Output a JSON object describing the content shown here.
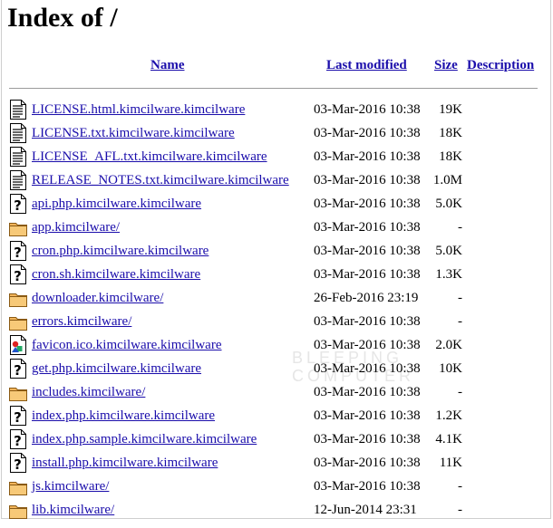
{
  "page": {
    "title": "Index of /"
  },
  "columns": {
    "name": "Name",
    "last_modified": "Last modified",
    "size": "Size",
    "description": "Description"
  },
  "watermark": {
    "line1": "BLEEPING",
    "line2": "COMPUTER"
  },
  "entries": [
    {
      "icon": "text-file-icon",
      "name": "LICENSE.html.kimcilware.kimcilware",
      "modified": "03-Mar-2016 10:38",
      "size": "19K"
    },
    {
      "icon": "text-file-icon",
      "name": "LICENSE.txt.kimcilware.kimcilware",
      "modified": "03-Mar-2016 10:38",
      "size": "18K"
    },
    {
      "icon": "text-file-icon",
      "name": "LICENSE_AFL.txt.kimcilware.kimcilware",
      "modified": "03-Mar-2016 10:38",
      "size": "18K"
    },
    {
      "icon": "text-file-icon",
      "name": "RELEASE_NOTES.txt.kimcilware.kimcilware",
      "modified": "03-Mar-2016 10:38",
      "size": "1.0M"
    },
    {
      "icon": "unknown-file-icon",
      "name": "api.php.kimcilware.kimcilware",
      "modified": "03-Mar-2016 10:38",
      "size": "5.0K"
    },
    {
      "icon": "folder-icon",
      "name": "app.kimcilware/",
      "modified": "03-Mar-2016 10:38",
      "size": "-"
    },
    {
      "icon": "unknown-file-icon",
      "name": "cron.php.kimcilware.kimcilware",
      "modified": "03-Mar-2016 10:38",
      "size": "5.0K"
    },
    {
      "icon": "unknown-file-icon",
      "name": "cron.sh.kimcilware.kimcilware",
      "modified": "03-Mar-2016 10:38",
      "size": "1.3K"
    },
    {
      "icon": "folder-icon",
      "name": "downloader.kimcilware/",
      "modified": "26-Feb-2016 23:19",
      "size": "-"
    },
    {
      "icon": "folder-icon",
      "name": "errors.kimcilware/",
      "modified": "03-Mar-2016 10:38",
      "size": "-"
    },
    {
      "icon": "image-file-icon",
      "name": "favicon.ico.kimcilware.kimcilware",
      "modified": "03-Mar-2016 10:38",
      "size": "2.0K"
    },
    {
      "icon": "unknown-file-icon",
      "name": "get.php.kimcilware.kimcilware",
      "modified": "03-Mar-2016 10:38",
      "size": "10K"
    },
    {
      "icon": "folder-icon",
      "name": "includes.kimcilware/",
      "modified": "03-Mar-2016 10:38",
      "size": "-"
    },
    {
      "icon": "unknown-file-icon",
      "name": "index.php.kimcilware.kimcilware",
      "modified": "03-Mar-2016 10:38",
      "size": "1.2K"
    },
    {
      "icon": "unknown-file-icon",
      "name": "index.php.sample.kimcilware.kimcilware",
      "modified": "03-Mar-2016 10:38",
      "size": "4.1K"
    },
    {
      "icon": "unknown-file-icon",
      "name": "install.php.kimcilware.kimcilware",
      "modified": "03-Mar-2016 10:38",
      "size": "11K"
    },
    {
      "icon": "folder-icon",
      "name": "js.kimcilware/",
      "modified": "03-Mar-2016 10:38",
      "size": "-"
    },
    {
      "icon": "folder-icon",
      "name": "lib.kimcilware/",
      "modified": "12-Jun-2014 23:31",
      "size": "-"
    }
  ]
}
